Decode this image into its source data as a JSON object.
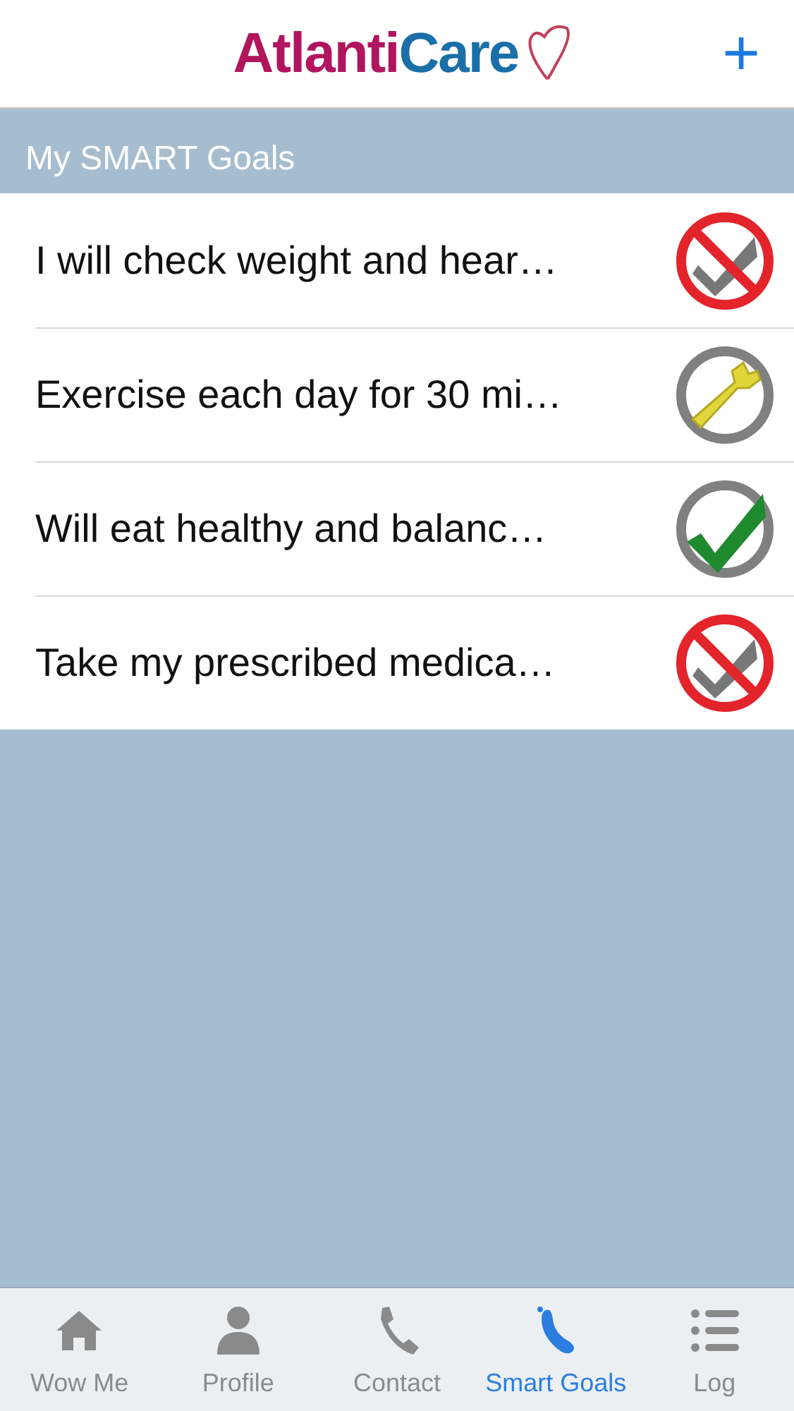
{
  "header": {
    "logo": {
      "part_1": "Atlanti",
      "part_2": "Care"
    },
    "add_button": "+"
  },
  "section": {
    "title": "My SMART Goals"
  },
  "goals": [
    {
      "text": "I will check weight and hear…",
      "kind": "not_done"
    },
    {
      "text": "Exercise each day for 30 mi…",
      "kind": "in_progress"
    },
    {
      "text": "Will eat healthy and balanc…",
      "kind": "done"
    },
    {
      "text": "Take my prescribed medica…",
      "kind": "not_done"
    }
  ],
  "tab_bar": [
    {
      "label": "Wow Me",
      "kind": "home",
      "selected": false
    },
    {
      "label": "Profile",
      "kind": "person",
      "selected": false
    },
    {
      "label": "Contact",
      "kind": "phone",
      "selected": false
    },
    {
      "label": "Smart Goals",
      "kind": "foot",
      "selected": true
    },
    {
      "label": "Log",
      "kind": "list",
      "selected": false
    }
  ]
}
